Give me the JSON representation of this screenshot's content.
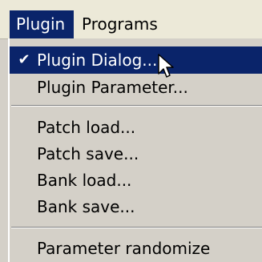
{
  "menubar": {
    "items": [
      {
        "label": "Plugin"
      },
      {
        "label": "Programs"
      }
    ]
  },
  "menu": {
    "items": [
      {
        "label": "Plugin Dialog...",
        "checked": true
      },
      {
        "label": "Plugin Parameter..."
      },
      {
        "label": "Patch load..."
      },
      {
        "label": "Patch save..."
      },
      {
        "label": "Bank load..."
      },
      {
        "label": "Bank save..."
      },
      {
        "label": "Parameter randomize"
      }
    ]
  },
  "icons": {
    "check": "✔",
    "cursor": "arrow-pointer-icon"
  },
  "colors": {
    "highlight": "#0a246a",
    "menu_background": "#d4d0c8",
    "menubar_background": "#ece9d8"
  }
}
